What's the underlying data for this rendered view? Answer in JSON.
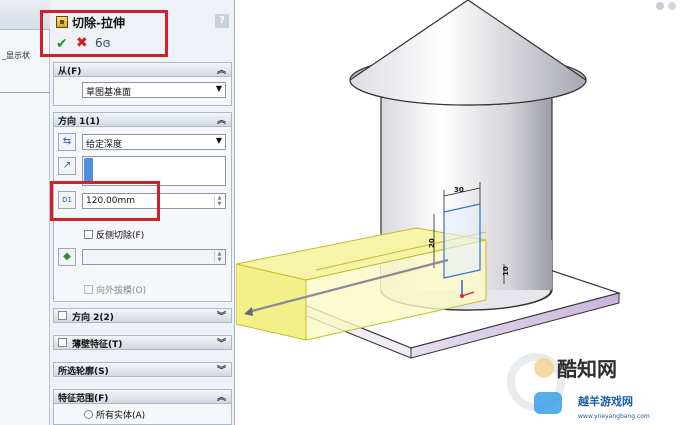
{
  "feature_tree": {
    "display_state_label": "_显示状"
  },
  "property_manager": {
    "title": "切除-拉伸",
    "help_label": "?",
    "ok_icon": "check-icon",
    "cancel_icon": "x-icon",
    "preview_icon": "glasses-icon",
    "from_group": {
      "label": "从(F)",
      "start_condition": "草图基准面"
    },
    "direction1_group": {
      "label": "方向 1(1)",
      "end_condition": "给定深度",
      "depth_value": "120.00mm",
      "flip_side_label": "反侧切除(F)",
      "draft_outward_label": "向外拔模(O)"
    },
    "direction2_group": {
      "label": "方向 2(2)"
    },
    "thin_feature_group": {
      "label": "薄壁特征(T)"
    },
    "selected_contours_group": {
      "label": "所选轮廓(S)"
    },
    "feature_scope_group": {
      "label": "特征范围(F)",
      "all_bodies_label": "所有实体(A)"
    }
  },
  "viewport": {
    "dimensions": {
      "width_label": "30",
      "height_label": "20",
      "offset_label": "10"
    }
  },
  "watermark": {
    "brand": "酷知网",
    "subtitle": "越羊游戏网",
    "url": "www.yneyangbang.com"
  },
  "colors": {
    "highlight_red": "#d0202a",
    "selection_yellow": "#f3f08a",
    "accent_blue": "#4f8fe0"
  }
}
